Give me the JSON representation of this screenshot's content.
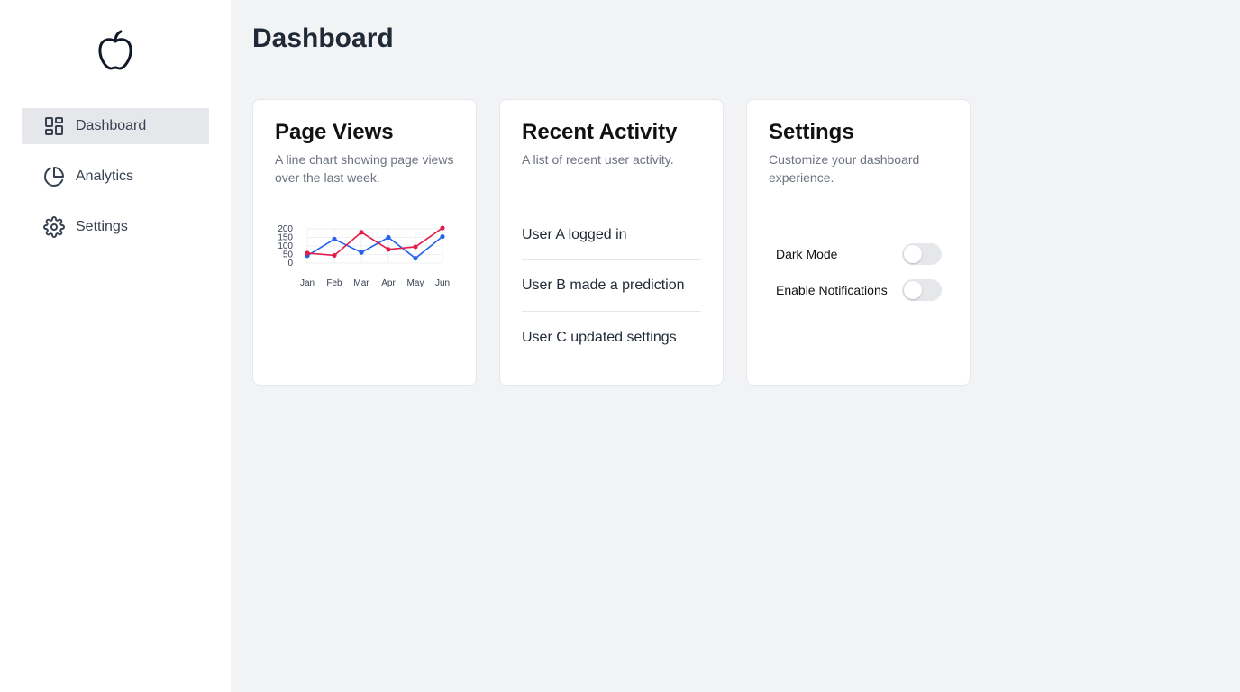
{
  "app": {
    "logo_icon": "apple-icon"
  },
  "sidebar": {
    "items": [
      {
        "label": "Dashboard",
        "icon": "dashboard-grid-icon",
        "active": true
      },
      {
        "label": "Analytics",
        "icon": "pie-chart-icon",
        "active": false
      },
      {
        "label": "Settings",
        "icon": "gear-icon",
        "active": false
      }
    ]
  },
  "header": {
    "title": "Dashboard"
  },
  "cards": {
    "page_views": {
      "title": "Page Views",
      "description": "A line chart showing page views over the last week."
    },
    "recent_activity": {
      "title": "Recent Activity",
      "description": "A list of recent user activity.",
      "items": [
        "User A logged in",
        "User B made a prediction",
        "User C updated settings"
      ]
    },
    "settings": {
      "title": "Settings",
      "description": "Customize your dashboard experience.",
      "toggles": [
        {
          "label": "Dark Mode",
          "on": false
        },
        {
          "label": "Enable Notifications",
          "on": false
        }
      ]
    }
  },
  "chart_data": {
    "type": "line",
    "categories": [
      "Jan",
      "Feb",
      "Mar",
      "Apr",
      "May",
      "Jun"
    ],
    "series": [
      {
        "color": "#2563eb",
        "values": [
          43,
          140,
          62,
          150,
          28,
          155
        ]
      },
      {
        "color": "#e11d48",
        "values": [
          58,
          45,
          180,
          80,
          95,
          205
        ]
      }
    ],
    "ylim": [
      0,
      200
    ],
    "yticks": [
      "200",
      "150",
      "100",
      "50",
      "0"
    ],
    "grid": true
  },
  "colors": {
    "sidebar_active": "#e5e7eb",
    "background": "#f2f3f5"
  }
}
